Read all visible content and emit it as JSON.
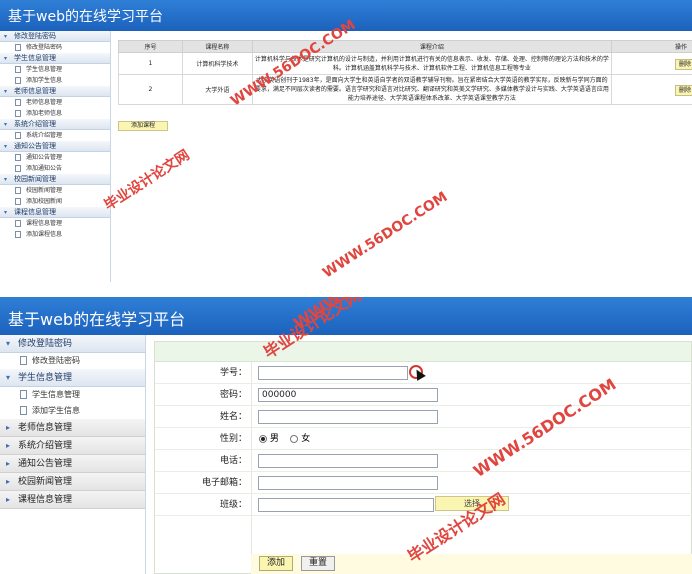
{
  "screen1": {
    "title": "基于web的在线学习平台",
    "sidebar": [
      {
        "label": "修改登陆密码",
        "items": [
          "修改登陆密码"
        ]
      },
      {
        "label": "学生信息管理",
        "items": [
          "学生信息管理",
          "添加学生信息"
        ]
      },
      {
        "label": "老师信息管理",
        "items": [
          "老师信息管理",
          "添加老师信息"
        ]
      },
      {
        "label": "系统介绍管理",
        "items": [
          "系统介绍管理"
        ]
      },
      {
        "label": "通知公告管理",
        "items": [
          "通知公告管理",
          "添加通知公告"
        ]
      },
      {
        "label": "校园新闻管理",
        "items": [
          "校园新闻管理",
          "添加校园新闻"
        ]
      },
      {
        "label": "课程信息管理",
        "items": [
          "课程信息管理",
          "添加课程信息"
        ]
      }
    ],
    "table": {
      "headers": [
        "序号",
        "课程名称",
        "课程介绍",
        "操作"
      ],
      "rows": [
        {
          "no": "1",
          "name": "计算机科学技术",
          "intro": "计算机科学与技术是研究计算机的设计与制造，并利用计算机进行有关的信息表示、收发、存储、处理、控制等的理论方法和技术的学科。计算机涵盖算机科学与技术、计算机软件工程、计算机信息工程等专业",
          "action": "删除"
        },
        {
          "no": "2",
          "name": "大学外语",
          "intro": "大学英语创刊于1983年，是面向大学生和英语自学者的双语教学辅导刊物。旨在紧密结合大学英语的教学实际，反映新与学同方面的要求，满足不同层次读者的需要。语言学研究和语言对比研究、翻译研究和英美文学研究、多媒体教学设计与实践、大学英语语言应用能力培养途径、大学英语课程体系改革、大学英语课堂教学方法",
          "action": "删除"
        }
      ]
    },
    "add_button": "添加课程"
  },
  "screen2": {
    "title": "基于web的在线学习平台",
    "sidebar": [
      {
        "label": "修改登陆密码",
        "items": [
          "修改登陆密码"
        ],
        "expanded": true
      },
      {
        "label": "学生信息管理",
        "items": [
          "学生信息管理",
          "添加学生信息"
        ],
        "expanded": true
      },
      {
        "label": "老师信息管理",
        "items": [],
        "expanded": false
      },
      {
        "label": "系统介绍管理",
        "items": [],
        "expanded": false
      },
      {
        "label": "通知公告管理",
        "items": [],
        "expanded": false
      },
      {
        "label": "校园新闻管理",
        "items": [],
        "expanded": false
      },
      {
        "label": "课程信息管理",
        "items": [],
        "expanded": false
      }
    ],
    "form": {
      "student_id_label": "学号：",
      "student_id_value": "",
      "password_label": "密码：",
      "password_value": "000000",
      "name_label": "姓名：",
      "name_value": "",
      "gender_label": "性别：",
      "gender_male": "男",
      "gender_female": "女",
      "gender_selected": "男",
      "phone_label": "电话：",
      "phone_value": "",
      "email_label": "电子邮箱：",
      "email_value": "",
      "class_label": "班级：",
      "class_value": "",
      "class_select_button": "选择",
      "submit_button": "添加",
      "reset_button": "重置"
    }
  },
  "watermarks": {
    "url": "WWW.56DOC.COM",
    "cn": "毕业设计论文网"
  }
}
